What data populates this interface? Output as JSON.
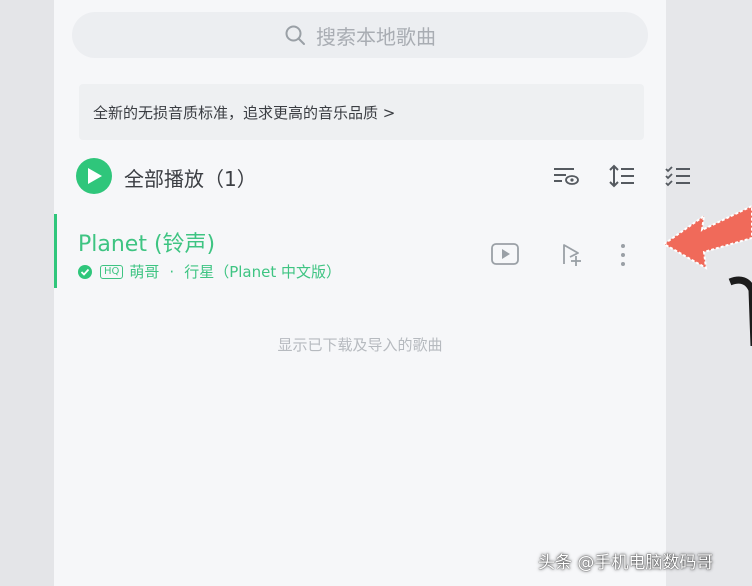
{
  "search": {
    "placeholder": "搜索本地歌曲",
    "icon": "search-icon"
  },
  "banner": {
    "text": "全新的无损音质标准，追求更高的音乐品质 >"
  },
  "playall": {
    "label": "全部播放（1）",
    "icons": [
      "view-icon",
      "sort-icon",
      "multi-select-icon"
    ]
  },
  "song": {
    "title": "Planet (铃声)",
    "quality_badge": "HQ",
    "artist": "萌哥",
    "separator": "·",
    "album": "行星（Planet 中文版）",
    "icons": [
      "downloaded-icon",
      "video-icon",
      "add-to-playlist-icon",
      "more-icon"
    ]
  },
  "hint": {
    "text": "显示已下载及导入的歌曲"
  },
  "watermark": {
    "text": "头条 @手机电脑数码哥"
  },
  "colors": {
    "accent": "#2fc67b",
    "annotation_arrow": "#f06a5a"
  }
}
